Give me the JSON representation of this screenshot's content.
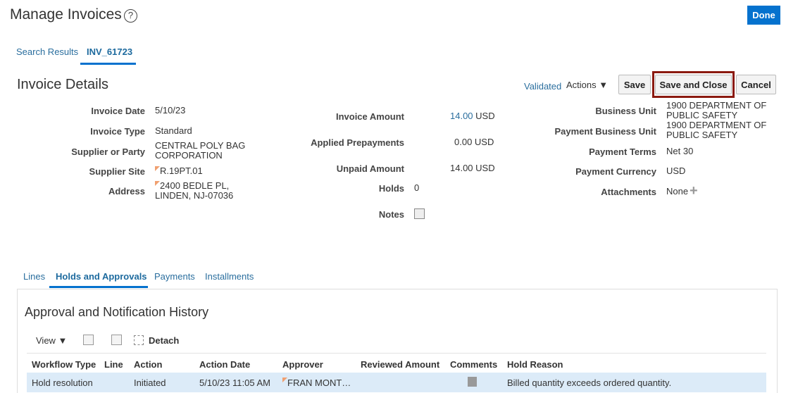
{
  "header": {
    "title": "Manage Invoices",
    "help": "?",
    "done": "Done"
  },
  "tabs": [
    "Search Results",
    "INV_61723"
  ],
  "details": {
    "title": "Invoice Details",
    "status": "Validated",
    "actions": "Actions ▼",
    "save": "Save",
    "save_close": "Save and Close",
    "cancel": "Cancel"
  },
  "col1": [
    {
      "label": "Invoice Date",
      "value": "5/10/23"
    },
    {
      "label": "Invoice Type",
      "value": "Standard"
    },
    {
      "label": "Supplier or Party",
      "value": "CENTRAL POLY BAG CORPORATION"
    },
    {
      "label": "Supplier Site",
      "value": "R.19PT.01"
    },
    {
      "label": "Address",
      "value": "2400 BEDLE PL, LINDEN, NJ-07036"
    }
  ],
  "col2": {
    "invoice_amount_label": "Invoice Amount",
    "invoice_amount": "14.00",
    "invoice_currency": "USD",
    "applied_label": "Applied Prepayments",
    "applied": "0.00 USD",
    "unpaid_label": "Unpaid Amount",
    "unpaid": "14.00 USD",
    "holds_label": "Holds",
    "holds": "0",
    "notes_label": "Notes"
  },
  "col3": [
    {
      "label": "Business Unit",
      "value": "1900 DEPARTMENT OF PUBLIC SAFETY"
    },
    {
      "label": "Payment Business Unit",
      "value": "1900 DEPARTMENT OF PUBLIC SAFETY"
    },
    {
      "label": "Payment Terms",
      "value": "Net 30"
    },
    {
      "label": "Payment Currency",
      "value": "USD"
    },
    {
      "label": "Attachments",
      "value": "None"
    }
  ],
  "subtabs": [
    "Lines",
    "Holds and Approvals",
    "Payments",
    "Installments"
  ],
  "history": {
    "title": "Approval and Notification History",
    "view": "View ▼",
    "detach": "Detach",
    "columns": [
      "Workflow Type",
      "Line",
      "Action",
      "Action Date",
      "Approver",
      "Reviewed Amount",
      "Comments",
      "Hold Reason"
    ],
    "rows": [
      [
        "Hold resolution",
        "",
        "Initiated",
        "5/10/23 11:05 AM",
        "FRAN MONT…",
        "",
        "",
        "Billed quantity exceeds ordered quantity."
      ]
    ]
  }
}
